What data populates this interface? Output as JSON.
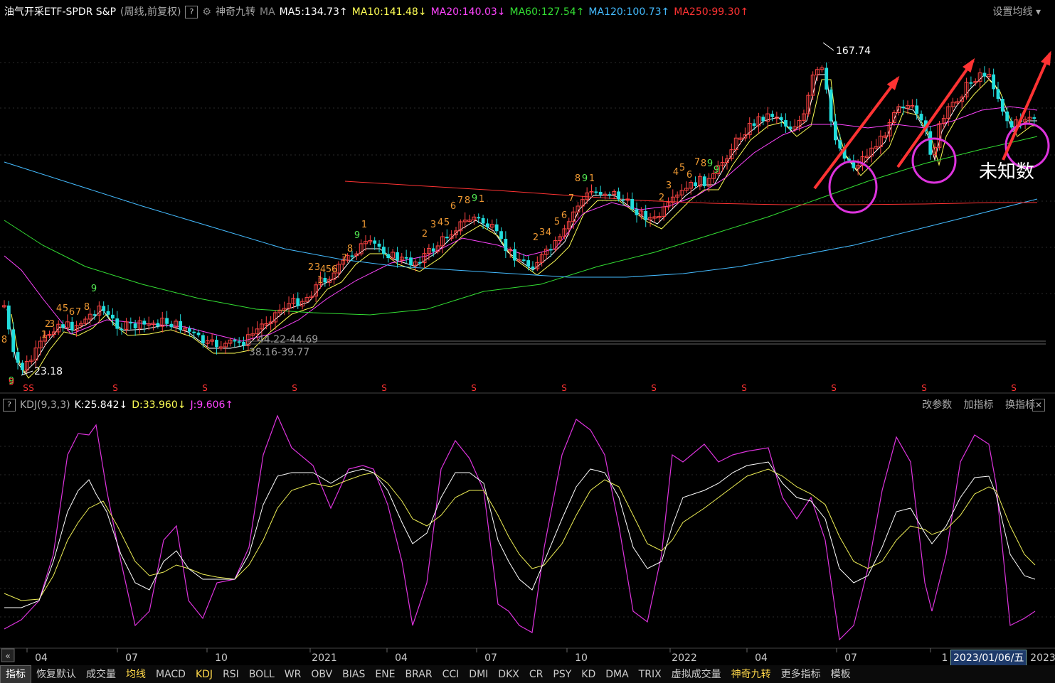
{
  "header": {
    "title": "油气开采ETF-SPDR S&P",
    "mode": "(周线,前复权)",
    "help": "?",
    "indicator_name": "神奇九转",
    "ma_label": "MA",
    "ma": [
      {
        "text": "MA5:134.73",
        "arrow": "↑",
        "color": "#ffffff"
      },
      {
        "text": "MA10:141.48",
        "arrow": "↓",
        "color": "#ffff55"
      },
      {
        "text": "MA20:140.03",
        "arrow": "↓",
        "color": "#ff44ff"
      },
      {
        "text": "MA60:127.54",
        "arrow": "↑",
        "color": "#33dd33"
      },
      {
        "text": "MA120:100.73",
        "arrow": "↑",
        "color": "#44bbff"
      },
      {
        "text": "MA250:99.30",
        "arrow": "↑",
        "color": "#ff3333"
      }
    ],
    "settings_label": "设置均线"
  },
  "price_labels": {
    "high": "167.74",
    "low": "23.18",
    "gap1": "44.22-44.69",
    "gap2": "38.16-39.77",
    "annotation": "未知数"
  },
  "kdj": {
    "help": "?",
    "name": "KDJ(9,3,3)",
    "k": "K:25.842",
    "k_arrow": "↓",
    "d": "D:33.960",
    "d_arrow": "↓",
    "j": "J:9.606",
    "j_arrow": "↑",
    "tools": [
      "改参数",
      "加指标",
      "换指标"
    ],
    "close": "✕"
  },
  "xaxis": [
    "04",
    "07",
    "10",
    "2021",
    "04",
    "07",
    "10",
    "2022",
    "04",
    "07",
    "1"
  ],
  "date_badge": "2023/01/06/五",
  "year_end": "2023",
  "bottom_tabs": [
    "指标",
    "恢复默认",
    "成交量",
    "均线",
    "MACD",
    "KDJ",
    "RSI",
    "BOLL",
    "WR",
    "OBV",
    "BIAS",
    "ENE",
    "BRAR",
    "CCI",
    "DMI",
    "DKX",
    "CR",
    "PSY",
    "KD",
    "DMA",
    "TRIX",
    "虚拟成交量",
    "神奇九转",
    "更多指标",
    "模板"
  ],
  "nine_turn": {
    "s_marker": "S",
    "labels": [
      "8",
      "9",
      "1",
      "2",
      "3",
      "4",
      "5",
      "6",
      "7",
      "8",
      "9",
      "1",
      "2",
      "3",
      "4",
      "5",
      "6",
      "7",
      "8",
      "9",
      "1",
      "2",
      "3",
      "4",
      "5",
      "6",
      "7",
      "8",
      "9",
      "1",
      "2",
      "3",
      "4",
      "5",
      "6",
      "7",
      "8",
      "9",
      "1",
      "2",
      "3",
      "4",
      "5",
      "6",
      "7",
      "8",
      "9"
    ]
  },
  "colors": {
    "up": "#ff4444",
    "down": "#22dddd",
    "ma5": "#ffffff",
    "ma10": "#ffff55",
    "ma20": "#ff44ff",
    "ma60": "#33dd33",
    "ma120": "#44bbff",
    "ma250": "#ff3333",
    "arrow": "#ff3333",
    "circle": "#dd33dd"
  }
}
